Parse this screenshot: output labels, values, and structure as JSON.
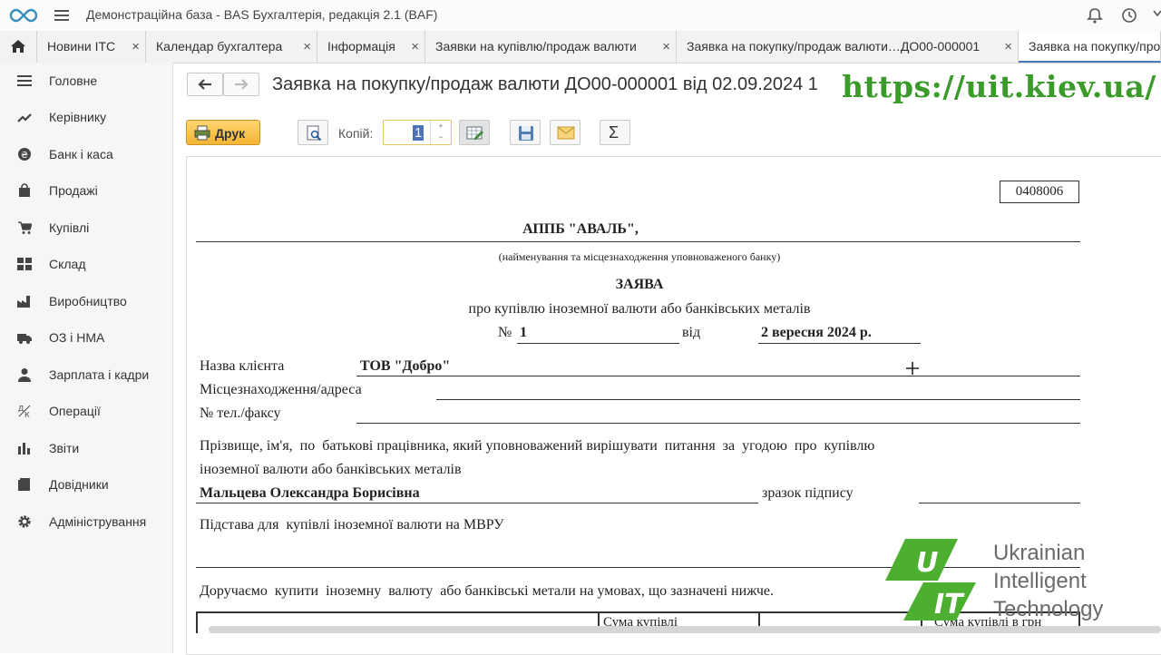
{
  "app": {
    "title": "Демонстраційна база - BAS Бухгалтерія, редакція 2.1  (BAF)"
  },
  "tabs": [
    {
      "label": "Новини ITC"
    },
    {
      "label": "Календар бухгалтера"
    },
    {
      "label": "Інформація"
    },
    {
      "label": "Заявки на купівлю/продаж валюти"
    },
    {
      "label": "Заявка на покупку/продаж валюти…ДО00-000001"
    },
    {
      "label": "Заявка на покупку/продаж валюти"
    }
  ],
  "sidebar": {
    "items": [
      {
        "label": "Головне",
        "icon": "menu-lines-icon"
      },
      {
        "label": "Керівнику",
        "icon": "trend-chart-icon"
      },
      {
        "label": "Банк і каса",
        "icon": "currency-coin-icon"
      },
      {
        "label": "Продажі",
        "icon": "shopping-bag-icon"
      },
      {
        "label": "Купівлі",
        "icon": "shopping-cart-icon"
      },
      {
        "label": "Склад",
        "icon": "warehouse-grid-icon"
      },
      {
        "label": "Виробництво",
        "icon": "factory-icon"
      },
      {
        "label": "ОЗ і НМА",
        "icon": "truck-icon"
      },
      {
        "label": "Зарплата і кадри",
        "icon": "person-icon"
      },
      {
        "label": "Операції",
        "icon": "operations-icon"
      },
      {
        "label": "Звіти",
        "icon": "bar-chart-icon"
      },
      {
        "label": "Довідники",
        "icon": "book-icon"
      },
      {
        "label": "Адміністрування",
        "icon": "gear-icon"
      }
    ]
  },
  "document": {
    "title": "Заявка на покупку/продаж валюти ДО00-000001 від 02.09.2024 1"
  },
  "watermark": {
    "url": "https://uit.kiev.ua/",
    "org_line1": "Ukrainian",
    "org_line2": "Intelligent",
    "org_line3": "Technology"
  },
  "toolbar": {
    "print_label": "Друк",
    "copies_label": "Копій:",
    "copies_value": "1",
    "sum_symbol": "Σ"
  },
  "form": {
    "form_number": "0408006",
    "bank_name": "АППБ \"АВАЛЬ\",",
    "bank_caption": "(найменування та місцезнаходження уповноваженого банку)",
    "heading": "ЗАЯВА",
    "subheading": "про купівлю іноземної валюти або банківських металів",
    "no_label": "№",
    "no_value": "1",
    "date_label": "від",
    "date_value": "2 вересня 2024 р.",
    "client_label": "Назва клієнта",
    "client_value": "ТОВ \"Добро\"",
    "address_label": "Місцезнаходження/адреса",
    "phone_label": "№ тел./факсу",
    "authorized_label_1": "Прізвище, ім'я,  по  батькові працівника, який уповноважений вирішувати  питання  за  угодою  про  купівлю",
    "authorized_label_2": "іноземної валюти або банківських металів",
    "authorized_value": "Мальцева Олександра Борисівна",
    "signature_label": "зразок підпису",
    "basis_label": "Підстава для  купівлі іноземної валюти на МВРУ",
    "instruction": "Доручаємо  купити  іноземну  валюту  або банківські метали на умовах, що зазначені нижче.",
    "table_col1": "Сума купівлі",
    "table_col2": "Сума купівлі в грн"
  },
  "colors": {
    "accent": "#4a79c0",
    "watermark_green": "#3a9a2a",
    "print_button": "#f3b533"
  }
}
